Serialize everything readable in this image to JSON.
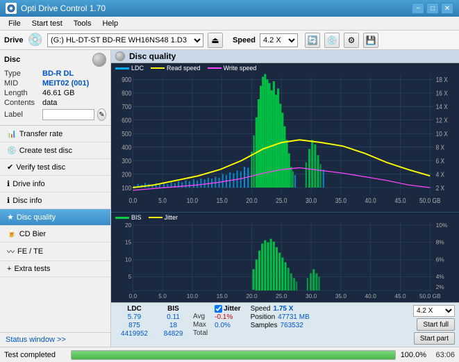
{
  "titlebar": {
    "title": "Opti Drive Control 1.70",
    "min": "−",
    "max": "□",
    "close": "✕"
  },
  "menubar": {
    "items": [
      "File",
      "Start test",
      "Tools",
      "Help"
    ]
  },
  "drivebar": {
    "drive_label": "Drive",
    "drive_value": "(G:)  HL-DT-ST BD-RE  WH16NS48 1.D3",
    "speed_label": "Speed",
    "speed_value": "4.2 X"
  },
  "disc": {
    "header": "Disc",
    "type_label": "Type",
    "type_value": "BD-R DL",
    "mid_label": "MID",
    "mid_value": "MEIT02 (001)",
    "length_label": "Length",
    "length_value": "46.61 GB",
    "contents_label": "Contents",
    "contents_value": "data",
    "label_label": "Label",
    "label_input": ""
  },
  "nav": {
    "items": [
      {
        "id": "transfer-rate",
        "label": "Transfer rate"
      },
      {
        "id": "create-test-disc",
        "label": "Create test disc"
      },
      {
        "id": "verify-test-disc",
        "label": "Verify test disc"
      },
      {
        "id": "drive-info",
        "label": "Drive info"
      },
      {
        "id": "disc-info",
        "label": "Disc info"
      },
      {
        "id": "disc-quality",
        "label": "Disc quality",
        "active": true
      },
      {
        "id": "cd-bier",
        "label": "CD Bier"
      },
      {
        "id": "fe-te",
        "label": "FE / TE"
      },
      {
        "id": "extra-tests",
        "label": "Extra tests"
      }
    ],
    "status_window": "Status window >>"
  },
  "chart": {
    "header": "Disc quality",
    "legend_upper": [
      {
        "id": "ldc",
        "label": "LDC",
        "color": "#00aaff"
      },
      {
        "id": "read-speed",
        "label": "Read speed",
        "color": "#ffff00"
      },
      {
        "id": "write-speed",
        "label": "Write speed",
        "color": "#ff44ff"
      }
    ],
    "legend_lower": [
      {
        "id": "bis",
        "label": "BIS",
        "color": "#00cc44"
      },
      {
        "id": "jitter",
        "label": "Jitter",
        "color": "#ffff00"
      }
    ],
    "upper_y_left": [
      "900",
      "800",
      "700",
      "600",
      "500",
      "400",
      "300",
      "200",
      "100"
    ],
    "upper_y_right": [
      "18 X",
      "16 X",
      "14 X",
      "12 X",
      "10 X",
      "8 X",
      "6 X",
      "4 X",
      "2 X"
    ],
    "lower_y_left": [
      "20",
      "15",
      "10",
      "5"
    ],
    "lower_y_right": [
      "10%",
      "8%",
      "6%",
      "4%",
      "2%"
    ],
    "x_labels": [
      "0.0",
      "5.0",
      "10.0",
      "15.0",
      "20.0",
      "25.0",
      "30.0",
      "35.0",
      "40.0",
      "45.0",
      "50.0 GB"
    ]
  },
  "stats": {
    "col_headers": [
      "LDC",
      "BIS",
      "Jitter"
    ],
    "avg_label": "Avg",
    "avg_ldc": "5.79",
    "avg_bis": "0.11",
    "avg_jitter": "-0.1%",
    "max_label": "Max",
    "max_ldc": "875",
    "max_bis": "18",
    "max_jitter": "0.0%",
    "total_label": "Total",
    "total_ldc": "4419952",
    "total_bis": "84829",
    "speed_label": "Speed",
    "speed_value": "1.75 X",
    "position_label": "Position",
    "position_value": "47731 MB",
    "samples_label": "Samples",
    "samples_value": "763532",
    "speed_select": "4.2 X",
    "start_full": "Start full",
    "start_part": "Start part",
    "jitter_checked": true
  },
  "statusbar": {
    "text": "Test completed",
    "progress": 100,
    "progress_label": "100.0%",
    "time": "63:06"
  }
}
